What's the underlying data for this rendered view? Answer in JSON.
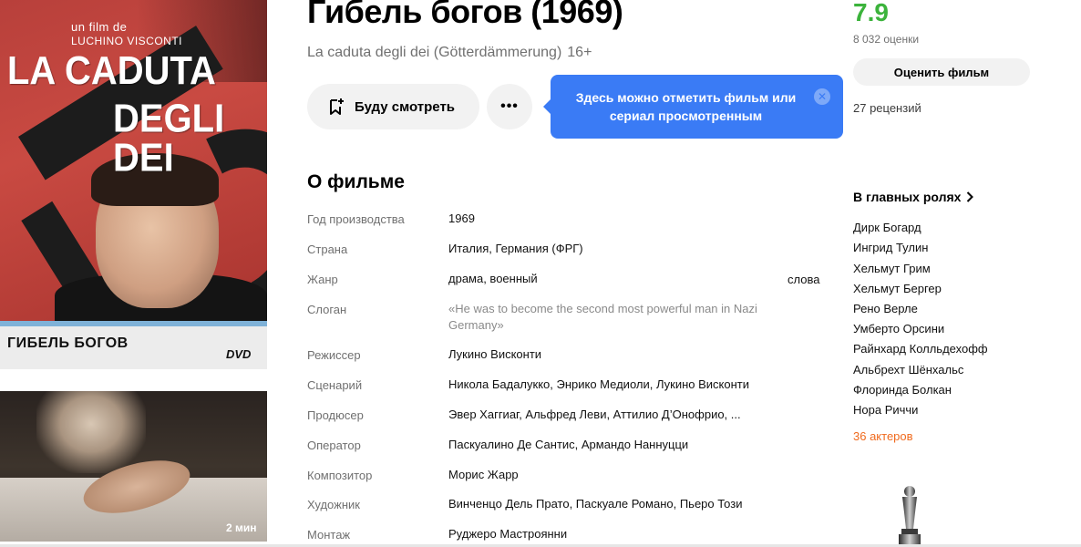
{
  "poster": {
    "credit_line1": "un film de",
    "credit_line2": "LUCHINO VISCONTI",
    "title_line1": "LA CADUTA",
    "title_line2": "DEGLI DEI",
    "rus_title": "ГИБЕЛЬ БОГОВ",
    "dvd_label": "DVD"
  },
  "trailer": {
    "duration": "2 мин"
  },
  "movie": {
    "title": "Гибель богов (1969)",
    "original_title": "La caduta degli dei (Götterdämmerung)",
    "age_rating": "16+"
  },
  "actions": {
    "watch_later_label": "Буду смотреть",
    "more_label": "•••"
  },
  "tooltip": {
    "text": "Здесь можно отметить фильм или сериал просмотренным",
    "close_label": "✕"
  },
  "rating": {
    "value": "7.9",
    "count_label": "8 032 оценки",
    "rate_button_label": "Оценить фильм",
    "reviews_label": "27 рецензий"
  },
  "about": {
    "heading": "О фильме",
    "rows": [
      {
        "label": "Год производства",
        "value": "1969"
      },
      {
        "label": "Страна",
        "value": "Италия, Германия (ФРГ)"
      },
      {
        "label": "Жанр",
        "value": "драма, военный"
      },
      {
        "label": "Слоган",
        "value": "«He was to become the second most powerful man in Nazi Germany»"
      },
      {
        "label": "Режиссер",
        "value": "Лукино Висконти"
      },
      {
        "label": "Сценарий",
        "value": "Никола Бадалукко, Энрико Медиоли, Лукино Висконти"
      },
      {
        "label": "Продюсер",
        "value": "Эвер Хаггиаг, Альфред Леви, Аттилио Д’Онофрио, ..."
      },
      {
        "label": "Оператор",
        "value": "Паскуалино Де Сантис, Армандо Наннуцци"
      },
      {
        "label": "Композитор",
        "value": "Морис Жарр"
      },
      {
        "label": "Художник",
        "value": "Винченцо Дель Прато, Паскуале Романо, Пьеро Този"
      },
      {
        "label": "Монтаж",
        "value": "Руджеро Мастроянни"
      }
    ],
    "genre_words_link": "слова"
  },
  "cast": {
    "heading": "В главных ролях",
    "actors": [
      "Дирк Богард",
      "Ингрид Тулин",
      "Хельмут Грим",
      "Хельмут Бергер",
      "Рено Верле",
      "Умберто Орсини",
      "Райнхард Колльдехофф",
      "Альбрехт Шёнхальс",
      "Флоринда Болкан",
      "Нора Риччи"
    ],
    "more_label": "36 актеров"
  }
}
